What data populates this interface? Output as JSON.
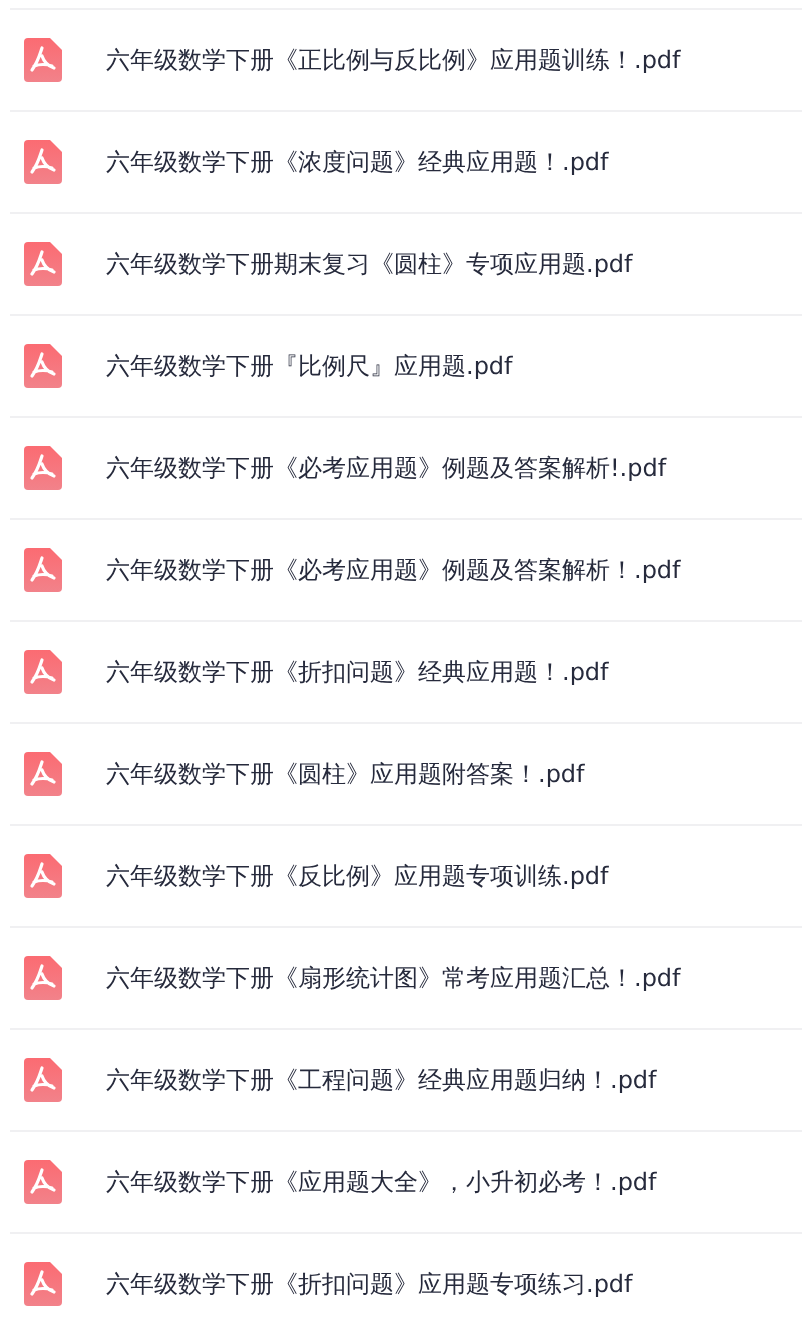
{
  "files": [
    {
      "name": "六年级数学下册《正比例与反比例》应用题训练！.pdf"
    },
    {
      "name": "六年级数学下册《浓度问题》经典应用题！.pdf"
    },
    {
      "name": "六年级数学下册期末复习《圆柱》专项应用题.pdf"
    },
    {
      "name": "六年级数学下册『比例尺』应用题.pdf"
    },
    {
      "name": "六年级数学下册《必考应用题》例题及答案解析!.pdf"
    },
    {
      "name": "六年级数学下册《必考应用题》例题及答案解析！.pdf"
    },
    {
      "name": "六年级数学下册《折扣问题》经典应用题！.pdf"
    },
    {
      "name": "六年级数学下册《圆柱》应用题附答案！.pdf"
    },
    {
      "name": "六年级数学下册《反比例》应用题专项训练.pdf"
    },
    {
      "name": "六年级数学下册《扇形统计图》常考应用题汇总！.pdf"
    },
    {
      "name": "六年级数学下册《工程问题》经典应用题归纳！.pdf"
    },
    {
      "name": "六年级数学下册《应用题大全》，小升初必考！.pdf"
    },
    {
      "name": "六年级数学下册《折扣问题》应用题专项练习.pdf"
    }
  ]
}
